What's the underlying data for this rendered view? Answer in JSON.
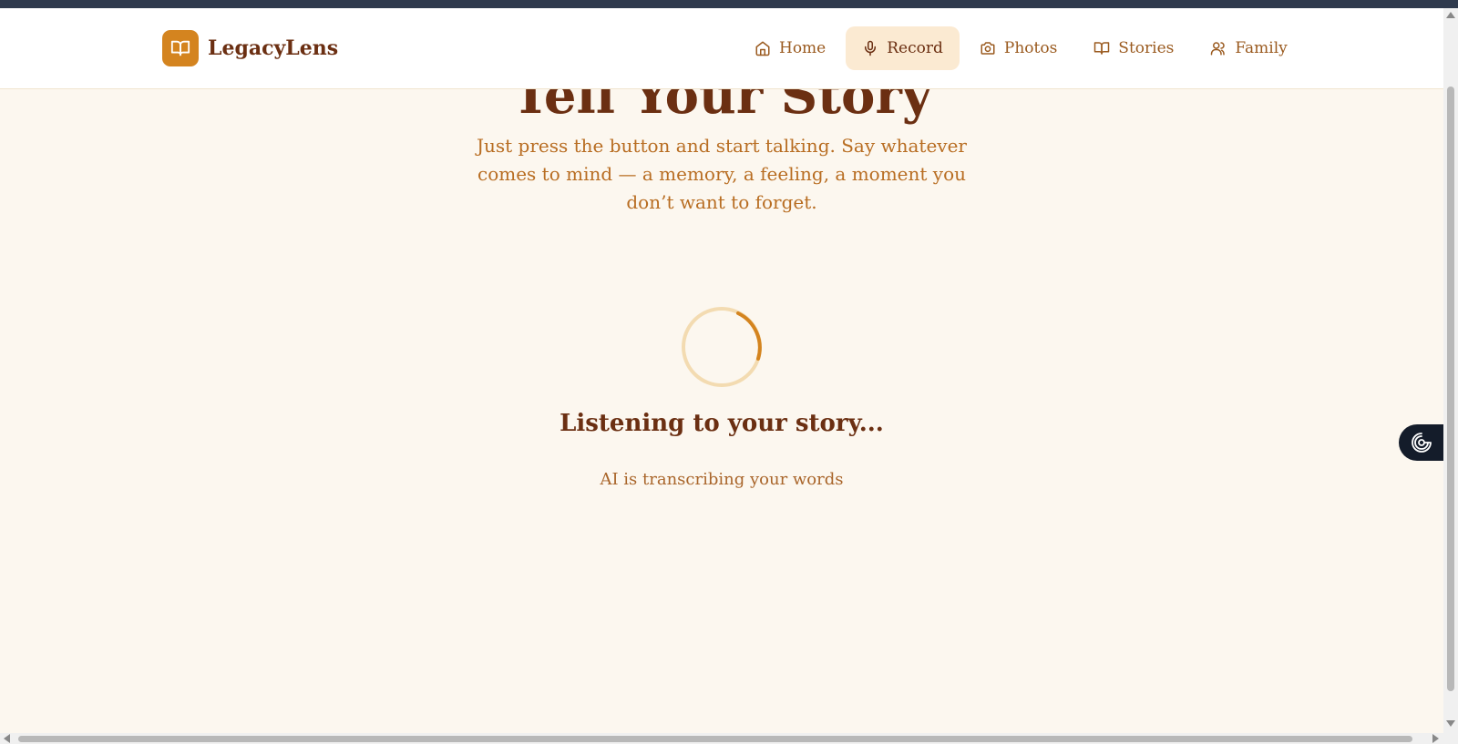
{
  "app": {
    "name": "LegacyLens"
  },
  "nav": {
    "items": [
      {
        "label": "Home",
        "icon": "home-icon"
      },
      {
        "label": "Record",
        "icon": "microphone-icon",
        "active": true
      },
      {
        "label": "Photos",
        "icon": "camera-icon"
      },
      {
        "label": "Stories",
        "icon": "book-icon"
      },
      {
        "label": "Family",
        "icon": "users-icon"
      }
    ]
  },
  "main": {
    "title": "Tell Your Story",
    "subtitle": "Just press the button and start talking. Say whatever comes to mind — a memory, a feeling, a moment you don’t want to forget.",
    "status_title": "Listening to your story...",
    "status_subtitle": "AI is transcribing your words"
  },
  "colors": {
    "accent": "#d4841f",
    "heading": "#6b2f12",
    "background": "#fcf7ef",
    "nav_active_bg": "#fbead2"
  }
}
